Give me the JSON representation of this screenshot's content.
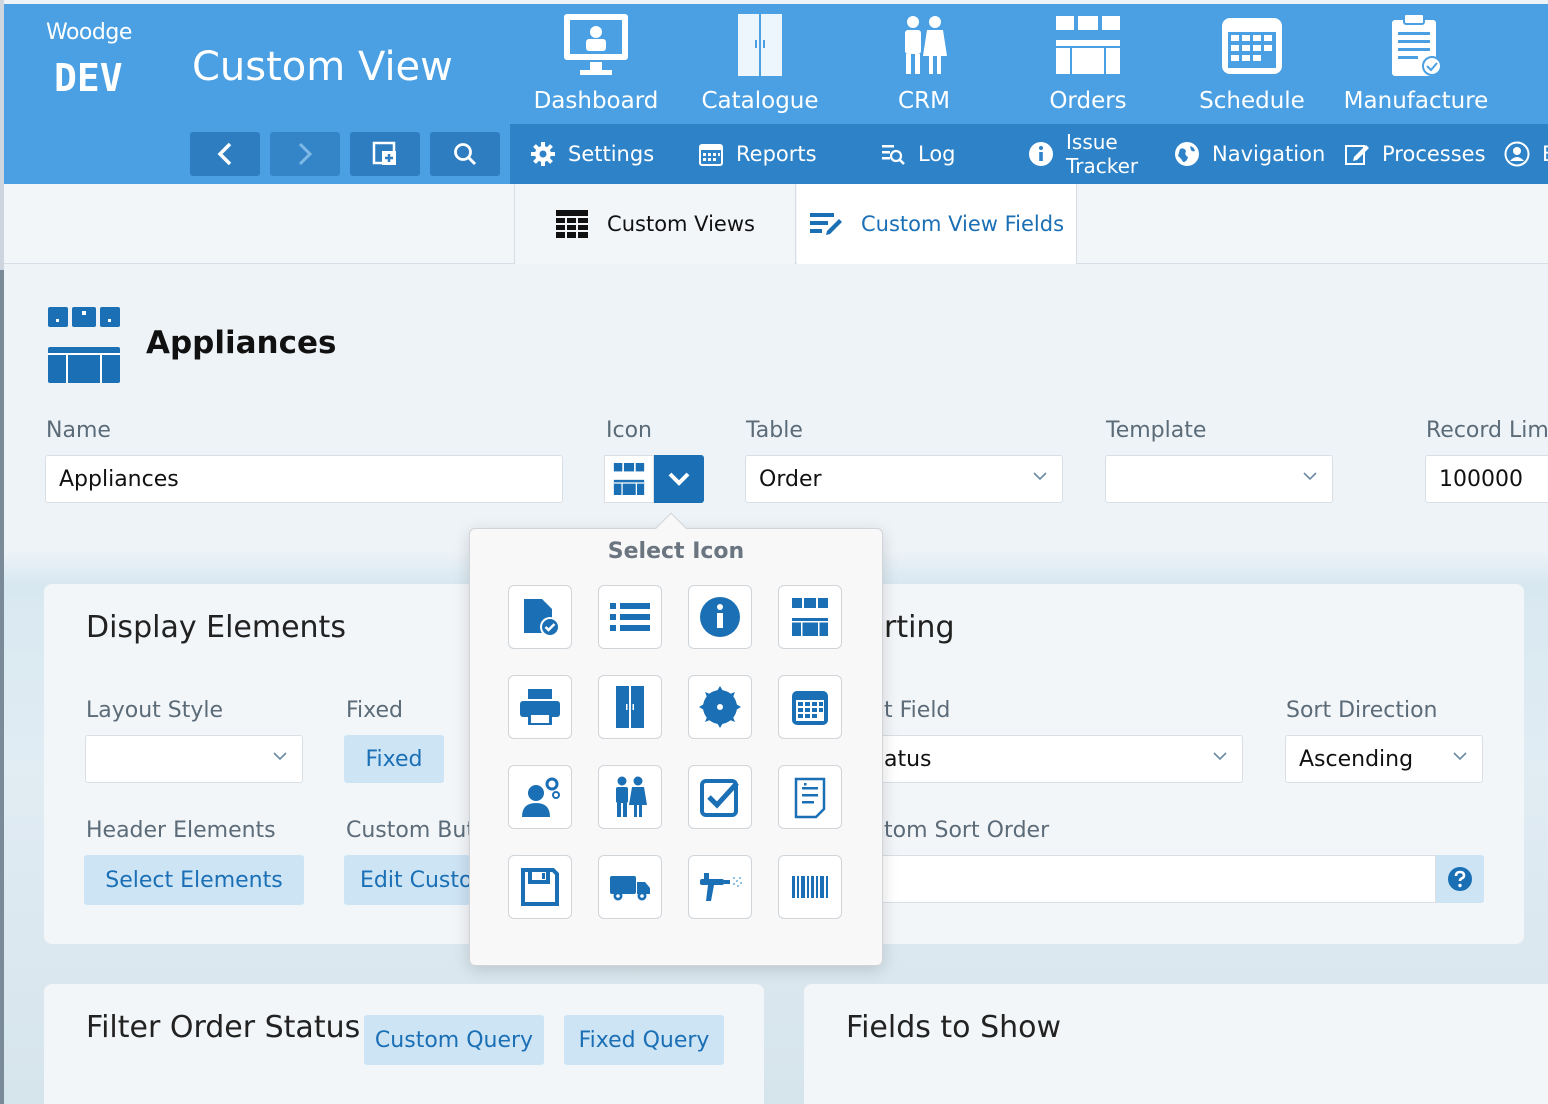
{
  "header": {
    "brand_name": "Woodge",
    "brand_env": "DEV",
    "page_title": "Custom View"
  },
  "main_nav": [
    {
      "label": "Dashboard",
      "icon": "dashboard-icon"
    },
    {
      "label": "Catalogue",
      "icon": "catalogue-icon"
    },
    {
      "label": "CRM",
      "icon": "crm-icon"
    },
    {
      "label": "Orders",
      "icon": "orders-icon"
    },
    {
      "label": "Schedule",
      "icon": "schedule-icon"
    },
    {
      "label": "Manufacture",
      "icon": "manufacture-icon"
    }
  ],
  "sub_nav": {
    "settings": "Settings",
    "reports": "Reports",
    "log": "Log",
    "issue_line1": "Issue",
    "issue_line2": "Tracker",
    "navigation": "Navigation",
    "processes": "Processes",
    "partial": "E"
  },
  "tabs": {
    "custom_views": "Custom Views",
    "custom_view_fields": "Custom View Fields"
  },
  "record": {
    "title": "Appliances"
  },
  "fields": {
    "name_label": "Name",
    "name_value": "Appliances",
    "icon_label": "Icon",
    "table_label": "Table",
    "table_value": "Order",
    "template_label": "Template",
    "template_value": "",
    "record_limit_label": "Record Lim",
    "record_limit_value": "100000"
  },
  "display_panel": {
    "title": "Display Elements",
    "layout_style_label": "Layout Style",
    "layout_style_value": "",
    "fixed_label": "Fixed",
    "fixed_button": "Fixed",
    "header_elements_label": "Header Elements",
    "select_elements_button": "Select Elements",
    "custom_buttons_label": "Custom But",
    "edit_custom_button": "Edit Custo"
  },
  "sorting_panel": {
    "title_partial": "rting",
    "sort_field_label_partial": "t Field",
    "sort_field_value_partial": "atus",
    "sort_direction_label": "Sort Direction",
    "sort_direction_value": "Ascending",
    "custom_sort_label_partial": "tom Sort Order"
  },
  "filter_panel": {
    "title": "Filter Order Status",
    "custom_query_button": "Custom Query",
    "fixed_query_button": "Fixed Query"
  },
  "fields_panel": {
    "title": "Fields to Show"
  },
  "icon_popover": {
    "title": "Select Icon",
    "icons": [
      "document-check-icon",
      "list-icon",
      "info-icon",
      "kitchen-icon",
      "printer-icon",
      "cabinet-icon",
      "saw-blade-icon",
      "calendar-icon",
      "user-settings-icon",
      "people-icon",
      "checkbox-icon",
      "clipboard-icon",
      "save-icon",
      "truck-icon",
      "spray-gun-icon",
      "barcode-icon"
    ]
  },
  "colors": {
    "header_blue": "#4aa0e3",
    "subnav_blue": "#2d82c8",
    "accent": "#1a6fb5",
    "light_button": "#cde4f5"
  }
}
